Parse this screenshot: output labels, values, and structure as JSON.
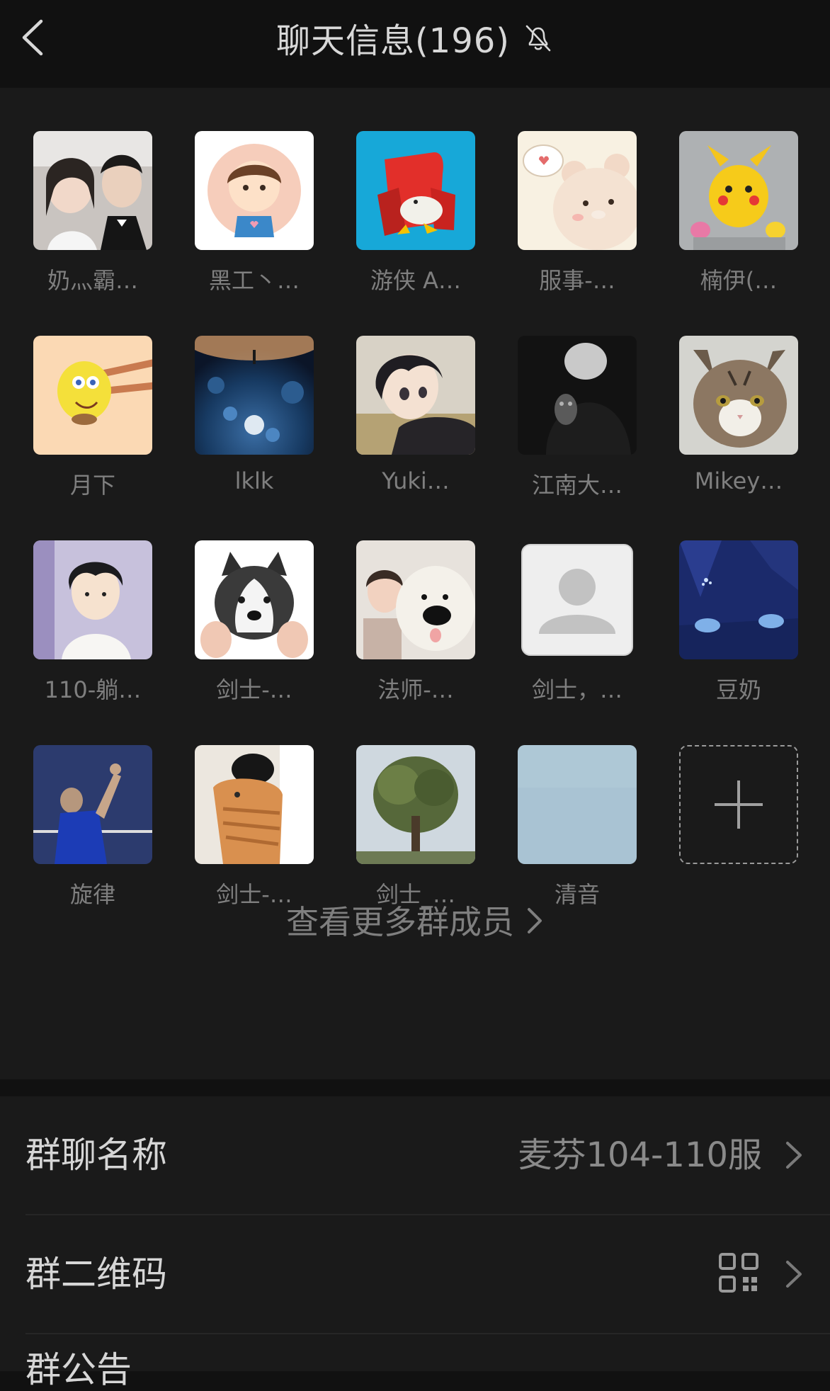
{
  "header": {
    "title": "聊天信息(196)",
    "back_icon": "chevron-left-icon",
    "mute_icon": "bell-off-icon"
  },
  "members": [
    {
      "name": "奶灬霸…",
      "avatar": "couple-photo"
    },
    {
      "name": "黑工丶…",
      "avatar": "cartoon-boy"
    },
    {
      "name": "游侠 A…",
      "avatar": "red-armchair"
    },
    {
      "name": "服事-…",
      "avatar": "cartoon-bear"
    },
    {
      "name": "楠伊(…",
      "avatar": "pikachu-figure"
    },
    {
      "name": "月下",
      "avatar": "spongebob-chopsticks"
    },
    {
      "name": "lklk",
      "avatar": "night-sky"
    },
    {
      "name": "Yuki…",
      "avatar": "anime-boy"
    },
    {
      "name": "江南大…",
      "avatar": "person-with-cat"
    },
    {
      "name": "Mikey…",
      "avatar": "tabby-cat"
    },
    {
      "name": "110-躺…",
      "avatar": "illustrated-man"
    },
    {
      "name": "剑士-…",
      "avatar": "husky-dog"
    },
    {
      "name": "法师-…",
      "avatar": "girl-with-bear"
    },
    {
      "name": "剑士，…",
      "avatar": "default-person"
    },
    {
      "name": "豆奶",
      "avatar": "blue-scene"
    },
    {
      "name": "旋律",
      "avatar": "badminton-player"
    },
    {
      "name": "剑士-…",
      "avatar": "orange-cat"
    },
    {
      "name": "剑士_…",
      "avatar": "tree"
    },
    {
      "name": "清音",
      "avatar": "pale-sky"
    }
  ],
  "add_member_icon": "plus-icon",
  "more_members_label": "查看更多群成员",
  "settings": {
    "group_name_label": "群聊名称",
    "group_name_value": "麦芬104-110服",
    "qr_label": "群二维码",
    "qr_icon": "qr-code-icon",
    "notice_label": "群公告"
  },
  "colors": {
    "background": "#111111",
    "panel": "#1a1a1a",
    "text_primary": "#d6d6d6",
    "text_secondary": "#7f7f7f"
  }
}
